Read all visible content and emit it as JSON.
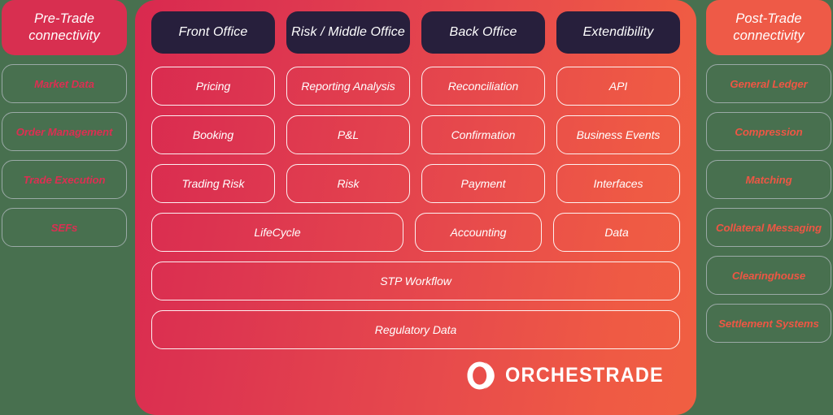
{
  "background_color": "#48704f",
  "left_panel": {
    "header": "Pre-Trade connectivity",
    "header_color": "#d82f50",
    "text_color": "#dc2f52",
    "items": [
      {
        "label": "Market Data"
      },
      {
        "label": "Order Management"
      },
      {
        "label": "Trade Execution"
      },
      {
        "label": "SEFs"
      }
    ]
  },
  "right_panel": {
    "header": "Post-Trade connectivity",
    "header_color": "#ee5a47",
    "text_color": "#ee5644",
    "items": [
      {
        "label": "General Ledger"
      },
      {
        "label": "Compression"
      },
      {
        "label": "Matching"
      },
      {
        "label": "Collateral Messaging"
      },
      {
        "label": "Clearinghouse"
      },
      {
        "label": "Settlement Systems"
      }
    ]
  },
  "main_panel": {
    "gradient_start": "#d9294f",
    "gradient_end": "#f05f42",
    "tab_color": "#271f3c",
    "tabs": [
      {
        "label": "Front Office"
      },
      {
        "label": "Risk / Middle Office"
      },
      {
        "label": "Back Office"
      },
      {
        "label": "Extendibility"
      }
    ],
    "rows": [
      {
        "cells": [
          {
            "label": "Pricing"
          },
          {
            "label": "Reporting Analysis"
          },
          {
            "label": "Reconciliation"
          },
          {
            "label": "API"
          }
        ]
      },
      {
        "cells": [
          {
            "label": "Booking"
          },
          {
            "label": "P&L"
          },
          {
            "label": "Confirmation"
          },
          {
            "label": "Business Events"
          }
        ]
      },
      {
        "cells": [
          {
            "label": "Trading Risk"
          },
          {
            "label": "Risk"
          },
          {
            "label": "Payment"
          },
          {
            "label": "Interfaces"
          }
        ]
      },
      {
        "cells": [
          {
            "label": "LifeCycle",
            "span": 2
          },
          {
            "label": "Accounting"
          },
          {
            "label": "Data"
          }
        ]
      },
      {
        "cells": [
          {
            "label": "STP Workflow",
            "span": 4
          }
        ]
      },
      {
        "cells": [
          {
            "label": "Regulatory Data",
            "span": 4
          }
        ]
      }
    ],
    "logo": {
      "icon": "orchestrade-o-mark-icon",
      "text": "ORCHESTRADE"
    }
  }
}
